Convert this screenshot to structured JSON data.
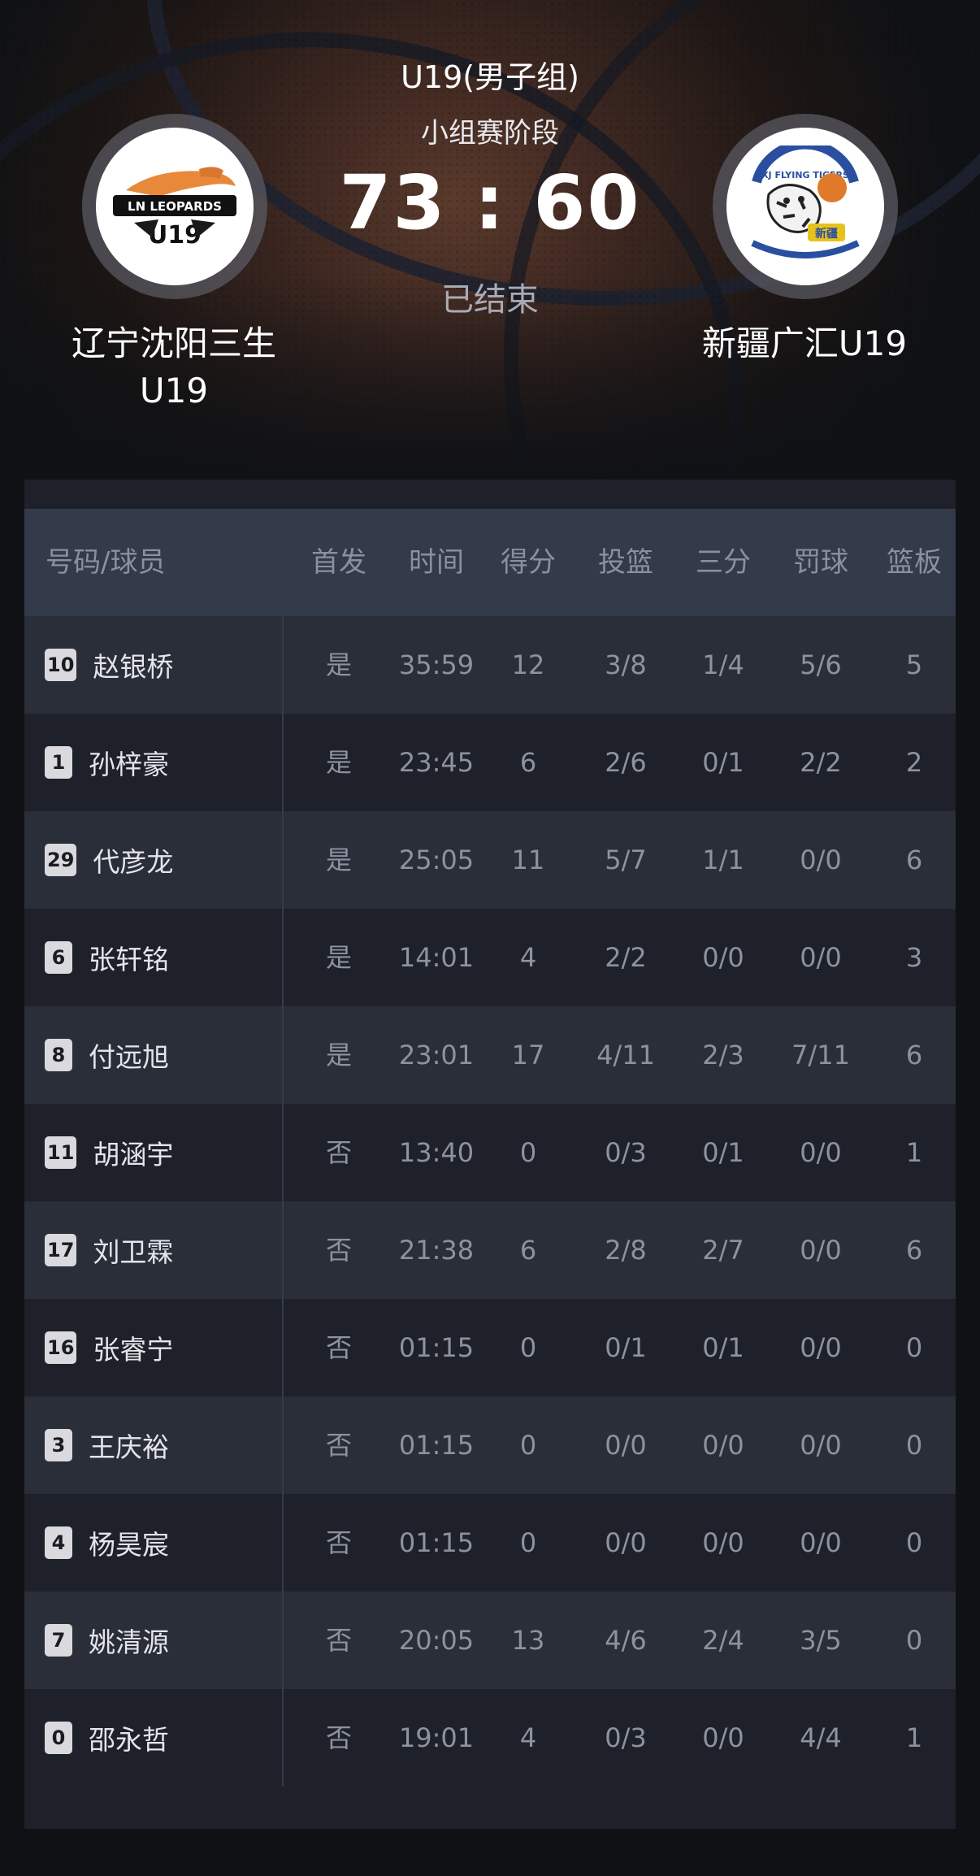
{
  "header": {
    "group": "U19(男子组)",
    "stage": "小组赛阶段",
    "score": "73 : 60",
    "status": "已结束"
  },
  "home_team": {
    "name_line1": "辽宁沈阳三生",
    "name_line2": "U19",
    "logo_text_top": "LN LEOPARDS",
    "logo_text_bottom": "U19"
  },
  "away_team": {
    "name": "新疆广汇U19",
    "logo_text_top": "XJ FLYING TIGERS",
    "logo_text_bottom": "新疆"
  },
  "table": {
    "columns": [
      "号码/球员",
      "首发",
      "时间",
      "得分",
      "投篮",
      "三分",
      "罚球",
      "篮板"
    ],
    "rows": [
      {
        "number": "10",
        "name": "赵银桥",
        "starter": "是",
        "time": "35:59",
        "points": "12",
        "fg": "3/8",
        "three": "1/4",
        "ft": "5/6",
        "reb": "5"
      },
      {
        "number": "1",
        "name": "孙梓豪",
        "starter": "是",
        "time": "23:45",
        "points": "6",
        "fg": "2/6",
        "three": "0/1",
        "ft": "2/2",
        "reb": "2"
      },
      {
        "number": "29",
        "name": "代彦龙",
        "starter": "是",
        "time": "25:05",
        "points": "11",
        "fg": "5/7",
        "three": "1/1",
        "ft": "0/0",
        "reb": "6"
      },
      {
        "number": "6",
        "name": "张轩铭",
        "starter": "是",
        "time": "14:01",
        "points": "4",
        "fg": "2/2",
        "three": "0/0",
        "ft": "0/0",
        "reb": "3"
      },
      {
        "number": "8",
        "name": "付远旭",
        "starter": "是",
        "time": "23:01",
        "points": "17",
        "fg": "4/11",
        "three": "2/3",
        "ft": "7/11",
        "reb": "6"
      },
      {
        "number": "11",
        "name": "胡涵宇",
        "starter": "否",
        "time": "13:40",
        "points": "0",
        "fg": "0/3",
        "three": "0/1",
        "ft": "0/0",
        "reb": "1"
      },
      {
        "number": "17",
        "name": "刘卫霖",
        "starter": "否",
        "time": "21:38",
        "points": "6",
        "fg": "2/8",
        "three": "2/7",
        "ft": "0/0",
        "reb": "6"
      },
      {
        "number": "16",
        "name": "张睿宁",
        "starter": "否",
        "time": "01:15",
        "points": "0",
        "fg": "0/1",
        "three": "0/1",
        "ft": "0/0",
        "reb": "0"
      },
      {
        "number": "3",
        "name": "王庆裕",
        "starter": "否",
        "time": "01:15",
        "points": "0",
        "fg": "0/0",
        "three": "0/0",
        "ft": "0/0",
        "reb": "0"
      },
      {
        "number": "4",
        "name": "杨昊宸",
        "starter": "否",
        "time": "01:15",
        "points": "0",
        "fg": "0/0",
        "three": "0/0",
        "ft": "0/0",
        "reb": "0"
      },
      {
        "number": "7",
        "name": "姚清源",
        "starter": "否",
        "time": "20:05",
        "points": "13",
        "fg": "4/6",
        "three": "2/4",
        "ft": "3/5",
        "reb": "0"
      },
      {
        "number": "0",
        "name": "邵永哲",
        "starter": "否",
        "time": "19:01",
        "points": "4",
        "fg": "0/3",
        "three": "0/0",
        "ft": "4/4",
        "reb": "1"
      }
    ]
  }
}
